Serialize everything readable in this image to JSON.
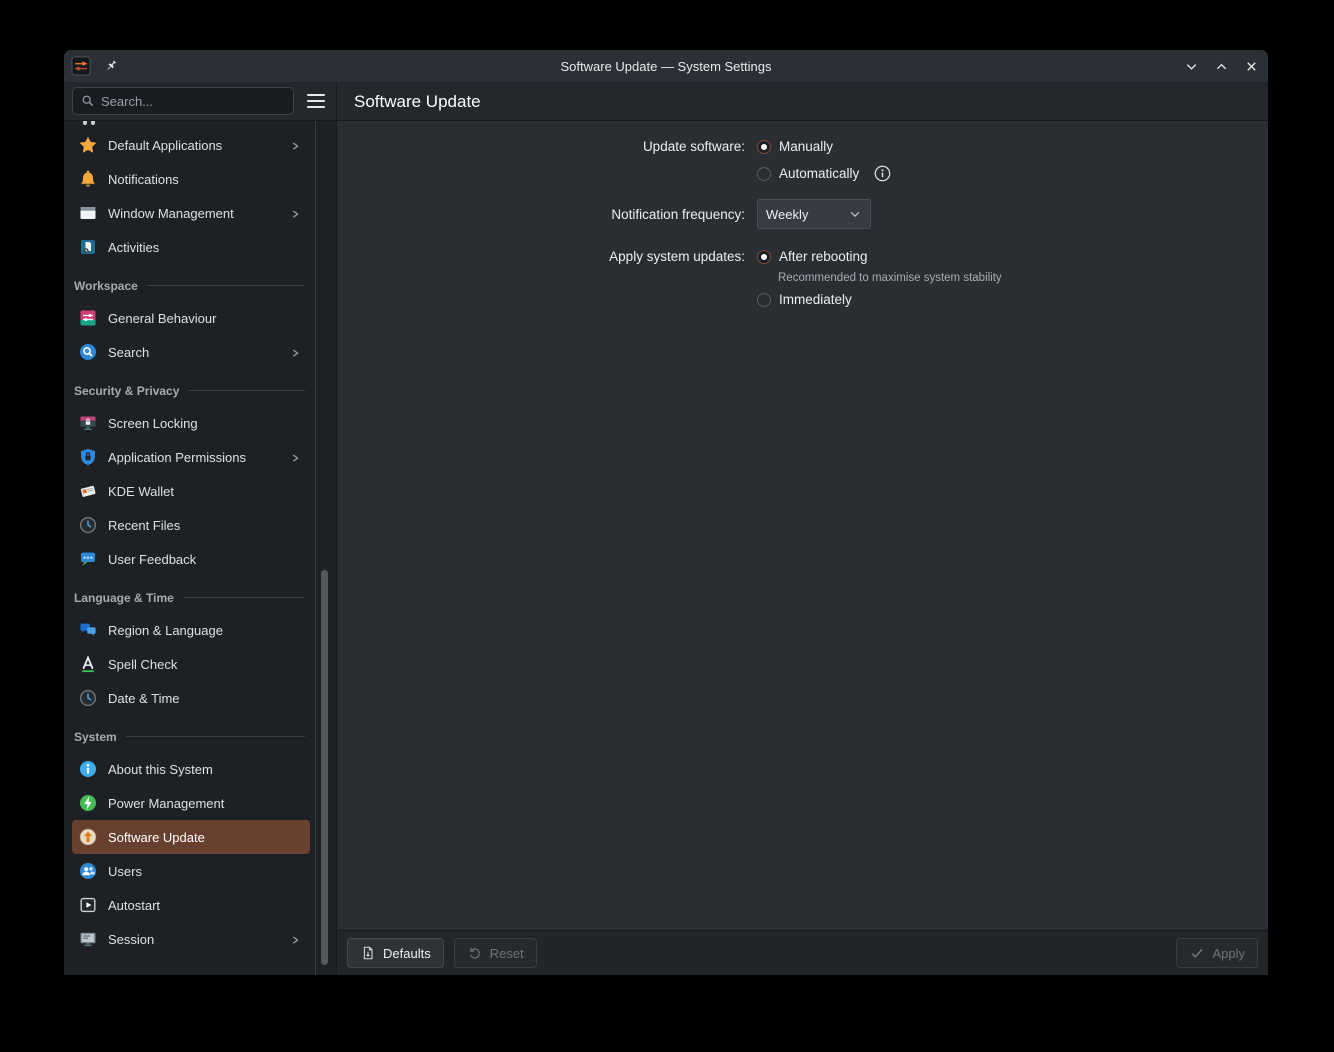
{
  "titlebar": {
    "title": "Software Update — System Settings"
  },
  "toolbar": {
    "search_placeholder": "Search...",
    "page_title": "Software Update"
  },
  "sidebar": {
    "sections": [
      {
        "header": null,
        "items": [
          {
            "icon": "star",
            "label": "Default Applications",
            "chevron": true
          },
          {
            "icon": "bell",
            "label": "Notifications"
          },
          {
            "icon": "window",
            "label": "Window Management",
            "chevron": true
          },
          {
            "icon": "activities",
            "label": "Activities"
          }
        ]
      },
      {
        "header": "Workspace",
        "items": [
          {
            "icon": "general-behaviour",
            "label": "General Behaviour"
          },
          {
            "icon": "search-blue",
            "label": "Search",
            "chevron": true
          }
        ]
      },
      {
        "header": "Security & Privacy",
        "items": [
          {
            "icon": "screen-locking",
            "label": "Screen Locking"
          },
          {
            "icon": "app-permissions",
            "label": "Application Permissions",
            "chevron": true
          },
          {
            "icon": "kde-wallet",
            "label": "KDE Wallet"
          },
          {
            "icon": "recent-files",
            "label": "Recent Files"
          },
          {
            "icon": "user-feedback",
            "label": "User Feedback"
          }
        ]
      },
      {
        "header": "Language & Time",
        "items": [
          {
            "icon": "region-language",
            "label": "Region & Language"
          },
          {
            "icon": "spell-check",
            "label": "Spell Check"
          },
          {
            "icon": "date-time",
            "label": "Date & Time"
          }
        ]
      },
      {
        "header": "System",
        "items": [
          {
            "icon": "about-system",
            "label": "About this System"
          },
          {
            "icon": "power",
            "label": "Power Management"
          },
          {
            "icon": "software-update",
            "label": "Software Update",
            "selected": true
          },
          {
            "icon": "users",
            "label": "Users"
          },
          {
            "icon": "autostart",
            "label": "Autostart"
          },
          {
            "icon": "session",
            "label": "Session",
            "chevron": true
          }
        ]
      }
    ]
  },
  "content": {
    "update_software": {
      "label": "Update software:",
      "options": [
        {
          "label": "Manually",
          "selected": true
        },
        {
          "label": "Automatically",
          "selected": false,
          "has_info": true
        }
      ]
    },
    "notification_frequency": {
      "label": "Notification frequency:",
      "value": "Weekly"
    },
    "apply_system_updates": {
      "label": "Apply system updates:",
      "options": [
        {
          "label": "After rebooting",
          "selected": true,
          "description": "Recommended to maximise system stability"
        },
        {
          "label": "Immediately",
          "selected": false
        }
      ]
    }
  },
  "footer": {
    "defaults": {
      "label": "Defaults",
      "enabled": true
    },
    "reset": {
      "label": "Reset",
      "enabled": false
    },
    "apply": {
      "label": "Apply",
      "enabled": false
    }
  },
  "icon_glyphs": {
    "minimize-icon": "⌄",
    "maximize-icon": "⌃",
    "close-icon": "✕",
    "hamburger-icon": "≡",
    "chevron-right-icon": "›",
    "chevron-down-icon": "⌄",
    "search-icon": "magnifier",
    "info-icon": "ⓘ",
    "check-icon": "✓",
    "undo-icon": "↺",
    "document-icon": "page",
    "pin-icon": "pushpin"
  },
  "colors": {
    "accent_selection": "#68402f",
    "titlebar_bg": "#2b3036",
    "sidebar_bg": "#1d2125",
    "content_bg": "#2a2e33",
    "footer_bg": "#232629",
    "text": "#eceff1"
  }
}
